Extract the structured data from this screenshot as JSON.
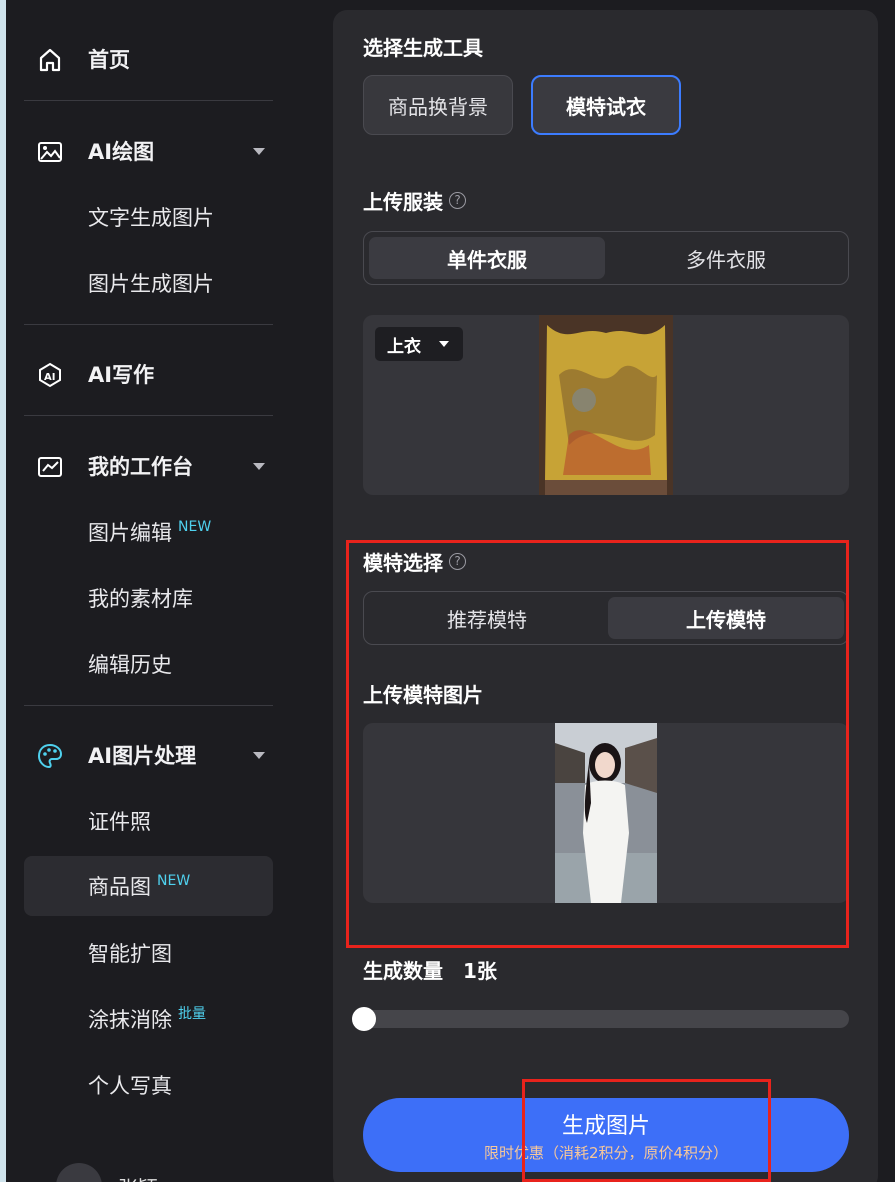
{
  "sidebar": {
    "home": "首页",
    "ai_draw": "AI绘图",
    "text_to_image": "文字生成图片",
    "image_to_image": "图片生成图片",
    "ai_write": "AI写作",
    "workspace": "我的工作台",
    "image_edit": "图片编辑",
    "image_edit_badge": "NEW",
    "material_lib": "我的素材库",
    "edit_history": "编辑历史",
    "ai_image_proc": "AI图片处理",
    "id_photo": "证件照",
    "product_image": "商品图",
    "product_image_badge": "NEW",
    "smart_expand": "智能扩图",
    "erase": "涂抹消除",
    "erase_badge": "批量",
    "portrait": "个人写真",
    "username": "张颖"
  },
  "panel": {
    "tool_title": "选择生成工具",
    "tool_options": [
      "商品换背景",
      "模特试衣"
    ],
    "tool_selected": "模特试衣",
    "upload_clothing_title": "上传服装",
    "clothing_tabs": [
      "单件衣服",
      "多件衣服"
    ],
    "clothing_selected": "单件衣服",
    "clothing_type": "上衣",
    "model_select_title": "模特选择",
    "model_tabs": [
      "推荐模特",
      "上传模特"
    ],
    "model_selected": "上传模特",
    "upload_model_title": "上传模特图片",
    "count_label": "生成数量",
    "count_value": "1张",
    "count_level": 0,
    "generate_label": "生成图片",
    "promo_label": "限时优惠（消耗2积分，原价4积分）"
  },
  "colors": {
    "accent": "#3d6ff8",
    "highlight": "#e8231c",
    "badge": "#4fd1ee"
  }
}
